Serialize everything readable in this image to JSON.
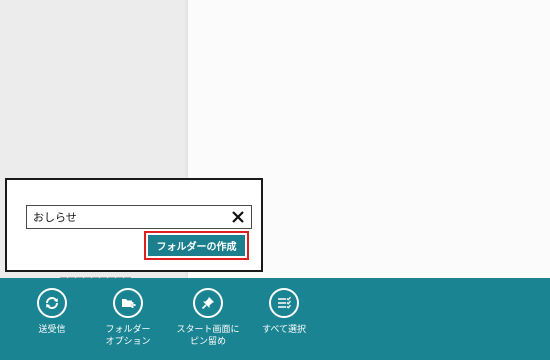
{
  "flyout": {
    "folder_name_value": "おしらせ",
    "create_folder_label": "フォルダーの作成"
  },
  "app_bar": {
    "buttons": [
      {
        "label": "送受信",
        "icon": "sync-icon"
      },
      {
        "label": "フォルダー\nオプション",
        "icon": "folder-options-icon"
      },
      {
        "label": "スタート画面に\nピン留め",
        "icon": "pin-icon"
      },
      {
        "label": "すべて選択",
        "icon": "select-all-icon"
      }
    ]
  },
  "colors": {
    "app_bar_bg": "#1a8492",
    "create_button_bg": "#1b7f8e",
    "highlight_border": "#e02020"
  }
}
